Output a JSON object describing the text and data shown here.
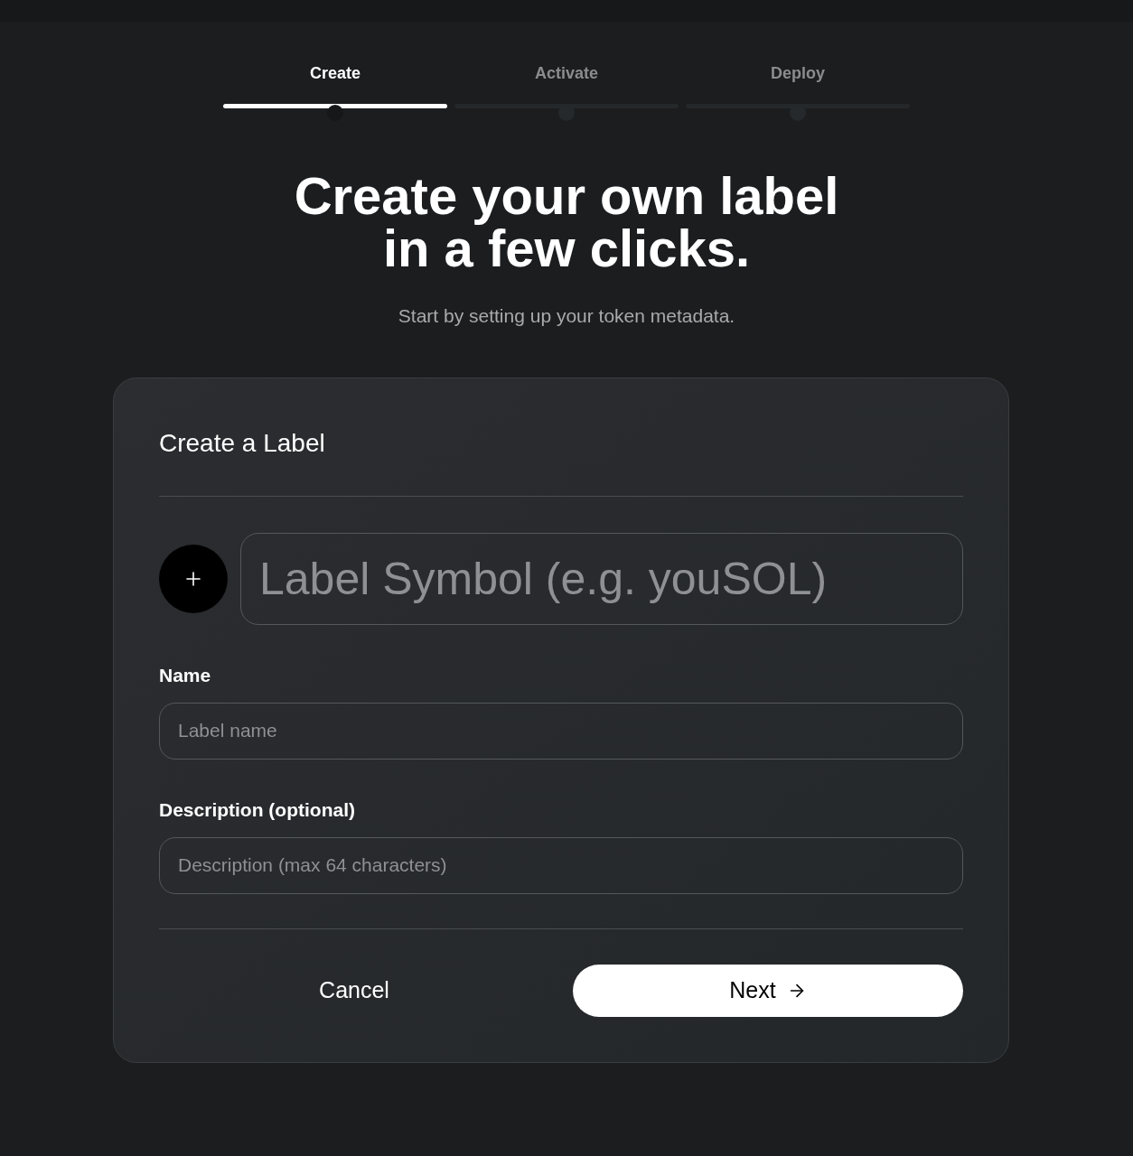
{
  "steps": [
    {
      "label": "Create",
      "selected": true
    },
    {
      "label": "Activate",
      "selected": false
    },
    {
      "label": "Deploy",
      "selected": false
    }
  ],
  "hero": {
    "title_line_1": "Create your own label",
    "title_line_2": "in a few clicks.",
    "subtitle": "Start by setting up your token metadata."
  },
  "card": {
    "title": "Create a Label",
    "symbol": {
      "placeholder": "Label Symbol (e.g. youSOL)"
    },
    "fields": [
      {
        "label": "Name",
        "placeholder": "Label name"
      },
      {
        "label": "Description (optional)",
        "placeholder": "Description (max 64 characters)"
      }
    ],
    "cancel": "Cancel",
    "next": "Next"
  }
}
